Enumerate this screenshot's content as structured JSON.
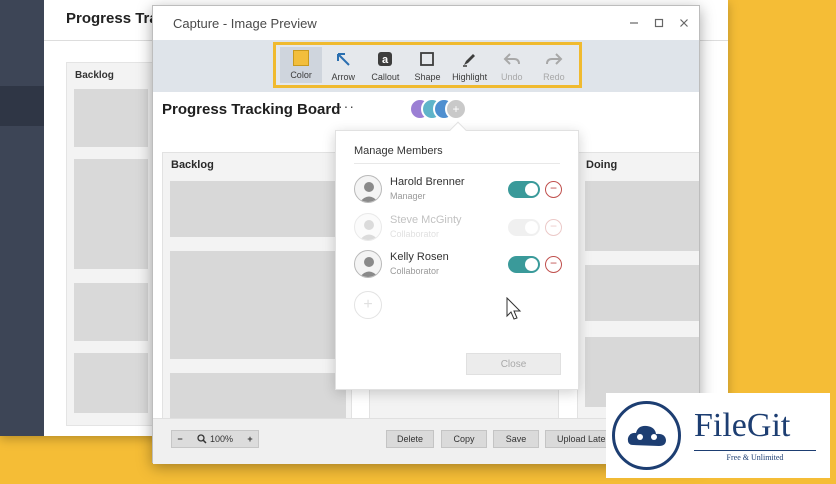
{
  "background_window": {
    "title": "Progress Tra",
    "column_label": "Backlog"
  },
  "capture_window": {
    "title": "Capture - Image Preview",
    "toolbar": [
      {
        "label": "Color",
        "icon": "color-swatch-icon",
        "state": "active"
      },
      {
        "label": "Arrow",
        "icon": "arrow-icon",
        "state": "enabled"
      },
      {
        "label": "Callout",
        "icon": "callout-icon",
        "state": "enabled"
      },
      {
        "label": "Shape",
        "icon": "shape-icon",
        "state": "enabled"
      },
      {
        "label": "Highlight",
        "icon": "highlight-icon",
        "state": "enabled"
      },
      {
        "label": "Undo",
        "icon": "undo-icon",
        "state": "disabled"
      },
      {
        "label": "Redo",
        "icon": "redo-icon",
        "state": "disabled"
      }
    ],
    "colors": {
      "accent": "#f0ba2f",
      "swatch": "#f2be3c",
      "toggle_on": "#3a9a9a",
      "remove": "#c0504d",
      "background": "#f5bd36"
    }
  },
  "board": {
    "title": "Progress Tracking Board",
    "more": "···",
    "columns": [
      "Backlog",
      "Doing"
    ]
  },
  "popup": {
    "title": "Manage Members",
    "members": [
      {
        "name": "Harold Brenner",
        "role": "Manager",
        "toggle": "on",
        "faded": false
      },
      {
        "name": "Steve McGinty",
        "role": "Collaborator",
        "toggle": "off",
        "faded": true
      },
      {
        "name": "Kelly Rosen",
        "role": "Collaborator",
        "toggle": "on",
        "faded": false
      }
    ],
    "add": "+",
    "close_label": "Close"
  },
  "bottom_bar": {
    "zoom_minus": "−",
    "zoom_plus": "+",
    "zoom_value": "100%",
    "buttons": [
      "Delete",
      "Copy",
      "Save",
      "Upload Late"
    ]
  },
  "watermark": {
    "name": "FileGit",
    "tagline": "Free & Unlimited"
  }
}
